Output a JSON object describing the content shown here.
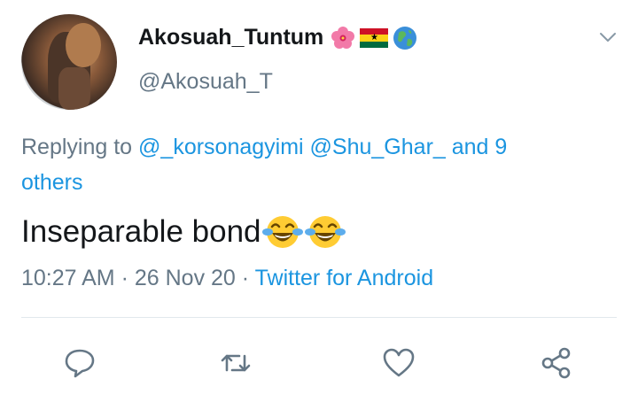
{
  "user": {
    "display_name": "Akosuah_Tuntum",
    "handle": "@Akosuah_T",
    "name_emojis": [
      "hibiscus-icon",
      "ghana-flag-icon",
      "globe-icon"
    ]
  },
  "reply": {
    "prefix": "Replying to",
    "mentions": [
      "@_korsonagyimi",
      "@Shu_Ghar_"
    ],
    "others": "and 9 others"
  },
  "tweet": {
    "text": "Inseparable bond",
    "emojis": [
      "face-with-tears-of-joy-icon",
      "face-with-tears-of-joy-icon"
    ]
  },
  "meta": {
    "time": "10:27 AM",
    "date": "26 Nov 20",
    "separator": "·",
    "source": "Twitter for Android"
  },
  "actions": [
    "reply-icon",
    "retweet-icon",
    "like-icon",
    "share-icon"
  ],
  "colors": {
    "text": "#14171a",
    "secondary": "#657786",
    "link": "#1b95e0",
    "divider": "#e1e8ed"
  }
}
